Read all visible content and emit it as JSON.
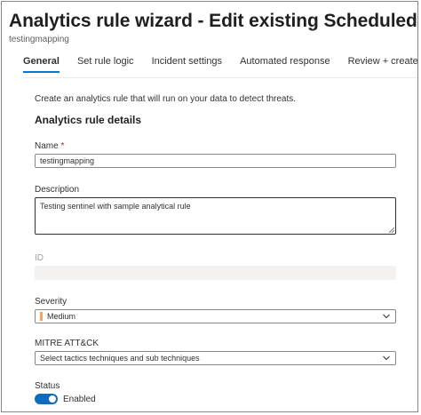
{
  "header": {
    "title": "Analytics rule wizard - Edit existing Scheduled rule",
    "more_glyph": "···",
    "subtitle": "testingmapping"
  },
  "tabs": [
    {
      "label": "General",
      "active": true
    },
    {
      "label": "Set rule logic",
      "active": false
    },
    {
      "label": "Incident settings",
      "active": false
    },
    {
      "label": "Automated response",
      "active": false
    },
    {
      "label": "Review + create",
      "active": false
    }
  ],
  "form": {
    "intro": "Create an analytics rule that will run on your data to detect threats.",
    "section_title": "Analytics rule details",
    "name": {
      "label": "Name",
      "required_mark": "*",
      "value": "testingmapping"
    },
    "description": {
      "label": "Description",
      "value": "Testing sentinel with sample analytical rule"
    },
    "id": {
      "label": "ID",
      "value": ""
    },
    "severity": {
      "label": "Severity",
      "value": "Medium",
      "color": "#f7a35c"
    },
    "mitre": {
      "label": "MITRE ATT&CK",
      "placeholder": "Select tactics techniques and sub techniques"
    },
    "status": {
      "label": "Status",
      "toggle_label": "Enabled",
      "enabled": true
    }
  },
  "colors": {
    "accent": "#0078d4",
    "toggle_on": "#0f6cbd"
  }
}
